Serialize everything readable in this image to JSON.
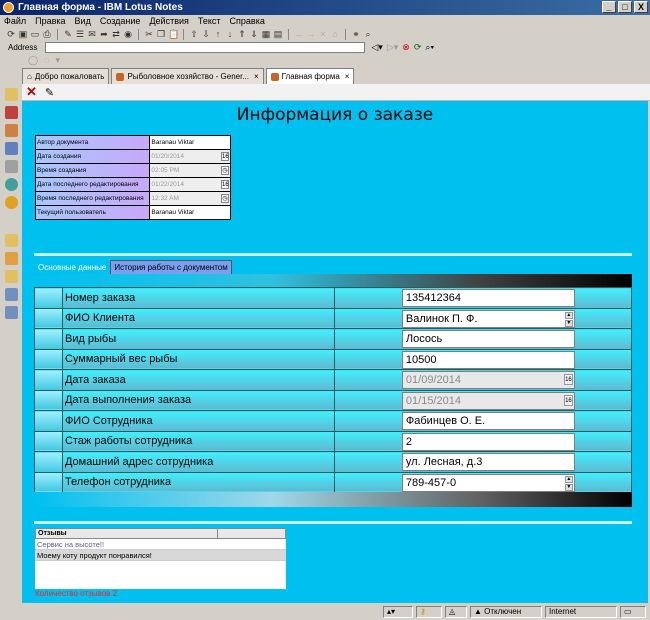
{
  "window": {
    "title": "Главная форма - IBM Lotus Notes",
    "buttons": [
      "_",
      "□",
      "X"
    ]
  },
  "menu": [
    "Файл",
    "Правка",
    "Вид",
    "Создание",
    "Действия",
    "Текст",
    "Справка"
  ],
  "address": {
    "label": "Address"
  },
  "tabs": [
    {
      "label": "Добро пожаловать",
      "active": false
    },
    {
      "label": "Рыболовное хозяйство - Gener...",
      "active": false
    },
    {
      "label": "Главная форма",
      "active": true
    }
  ],
  "form": {
    "title": "Информация о заказе",
    "meta": [
      {
        "label": "Автор документа",
        "value": "Baranau Viktar",
        "disabled": false,
        "icon": ""
      },
      {
        "label": "Дата создания",
        "value": "01/20/2014",
        "disabled": true,
        "icon": "calendar"
      },
      {
        "label": "Время создания",
        "value": "02:05 PM",
        "disabled": true,
        "icon": "clock"
      },
      {
        "label": "Дата последнего редактирования",
        "value": "01/22/2014",
        "disabled": true,
        "icon": "calendar"
      },
      {
        "label": "Время последнего редактирования",
        "value": "12:32 AM",
        "disabled": true,
        "icon": "clock"
      },
      {
        "label": "Текущий пользователь",
        "value": "Baranau Viktar",
        "disabled": false,
        "icon": ""
      }
    ],
    "subtabs": [
      {
        "label": "Основные данные",
        "active": true
      },
      {
        "label": "История работы с документом",
        "active": false
      }
    ],
    "fields": [
      {
        "label": "Номер заказа",
        "value": "135412364",
        "disabled": false,
        "control": ""
      },
      {
        "label": "ФИО Клиента",
        "value": "Валинок П. Ф.",
        "disabled": false,
        "control": "spin"
      },
      {
        "label": "Вид рыбы",
        "value": "Лосось",
        "disabled": false,
        "control": ""
      },
      {
        "label": "Суммарный вес рыбы",
        "value": "10500",
        "disabled": false,
        "control": ""
      },
      {
        "label": "Дата заказа",
        "value": "01/09/2014",
        "disabled": true,
        "control": "calendar"
      },
      {
        "label": "Дата выполнения заказа",
        "value": "01/15/2014",
        "disabled": true,
        "control": "calendar"
      },
      {
        "label": "ФИО Сотрудника",
        "value": "Фабинцев О. Е.",
        "disabled": false,
        "control": ""
      },
      {
        "label": "Стаж работы сотрудника",
        "value": "2",
        "disabled": false,
        "control": ""
      },
      {
        "label": "Домашний адрес сотрудника",
        "value": "ул. Лесная, д.3",
        "disabled": false,
        "control": ""
      },
      {
        "label": "Телефон сотрудника",
        "value": "789-457-0",
        "disabled": false,
        "control": "spin"
      }
    ],
    "reviews": {
      "header": "Отзывы",
      "items": [
        "Сервис на высоте!!",
        "Моему коту продукт понравился!"
      ],
      "count_label": "Количество отзывов 2"
    }
  },
  "status": {
    "offline": "Отключен",
    "location": "Internet"
  }
}
